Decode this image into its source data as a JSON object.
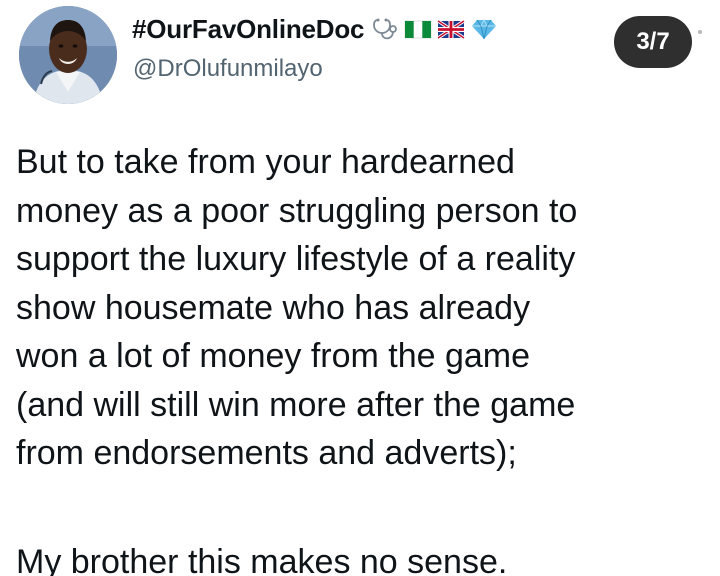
{
  "header": {
    "display_name": "#OurFavOnlineDoc",
    "name_emojis": [
      "stethoscope-icon",
      "nigeria-flag-icon",
      "uk-flag-icon",
      "diamond-icon"
    ],
    "handle": "@DrOlufunmilayo",
    "page_indicator": "3/7"
  },
  "tweet": {
    "lines": [
      "But to take from your hardearned",
      "money as a poor struggling person to",
      "support the luxury lifestyle of a reality",
      "show housemate who has already",
      "won a lot of money from the game",
      "(and will still win more after the game",
      "from endorsements and adverts);"
    ],
    "next_paragraph": "My brother this makes no sense."
  },
  "colors": {
    "text": "#0f1419",
    "secondary_text": "#536471",
    "pill_background": "#2f2f2f",
    "pill_text": "#ffffff",
    "background": "#ffffff"
  }
}
